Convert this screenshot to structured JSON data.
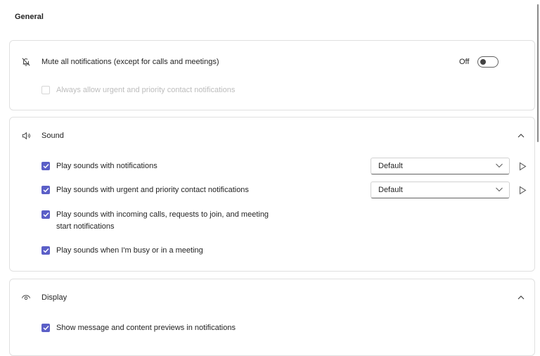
{
  "page": {
    "heading": "General"
  },
  "mute_card": {
    "label": "Mute all notifications (except for calls and meetings)",
    "toggle_state": "Off",
    "sub_label": "Always allow urgent and priority contact notifications",
    "icon": "bell-off-icon"
  },
  "sound_card": {
    "title": "Sound",
    "icon": "speaker-icon",
    "items": [
      {
        "label": "Play sounds with notifications",
        "checked": true,
        "select": "Default"
      },
      {
        "label": "Play sounds with urgent and priority contact notifications",
        "checked": true,
        "select": "Default"
      },
      {
        "label_line1": "Play sounds with incoming calls, requests to join, and meeting",
        "label_line2": "start notifications",
        "checked": true
      },
      {
        "label": "Play sounds when I'm busy or in a meeting",
        "checked": true
      }
    ]
  },
  "display_card": {
    "title": "Display",
    "icon": "eye-icon",
    "items": [
      {
        "label": "Show message and content previews in notifications",
        "checked": true
      }
    ]
  },
  "colors": {
    "accent": "#5b5fc7",
    "border": "#e0e0e0",
    "text": "#242424",
    "disabled": "#bdbdbd"
  }
}
